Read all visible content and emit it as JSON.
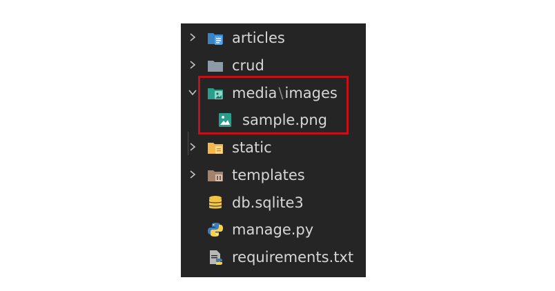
{
  "explorer": {
    "items": [
      {
        "label": "articles",
        "icon": "folder-blue-doc-icon",
        "chevron": "right"
      },
      {
        "label": "crud",
        "icon": "folder-grey-icon",
        "chevron": "right"
      },
      {
        "label_parts": [
          "media",
          "\\",
          "images"
        ],
        "icon": "folder-teal-image-icon",
        "chevron": "down"
      },
      {
        "label": "sample.png",
        "icon": "image-file-icon"
      },
      {
        "label": "static",
        "icon": "folder-yellow-icon",
        "chevron": "right"
      },
      {
        "label": "templates",
        "icon": "folder-brown-icon",
        "chevron": "right"
      },
      {
        "label": "db.sqlite3",
        "icon": "database-icon"
      },
      {
        "label": "manage.py",
        "icon": "python-icon"
      },
      {
        "label": "requirements.txt",
        "icon": "text-file-python-icon"
      }
    ]
  },
  "colors": {
    "panel_bg": "#252526",
    "text": "#d7d7d7",
    "highlight_border": "#c4121a",
    "folder_blue": "#3b82c4",
    "folder_grey": "#8e9aa5",
    "folder_teal": "#2a9d8f",
    "folder_yellow": "#f2b84b",
    "folder_brown": "#a5826e",
    "db_yellow": "#f2c443",
    "python_blue": "#3f7cb8",
    "python_yellow": "#f6d24a"
  }
}
